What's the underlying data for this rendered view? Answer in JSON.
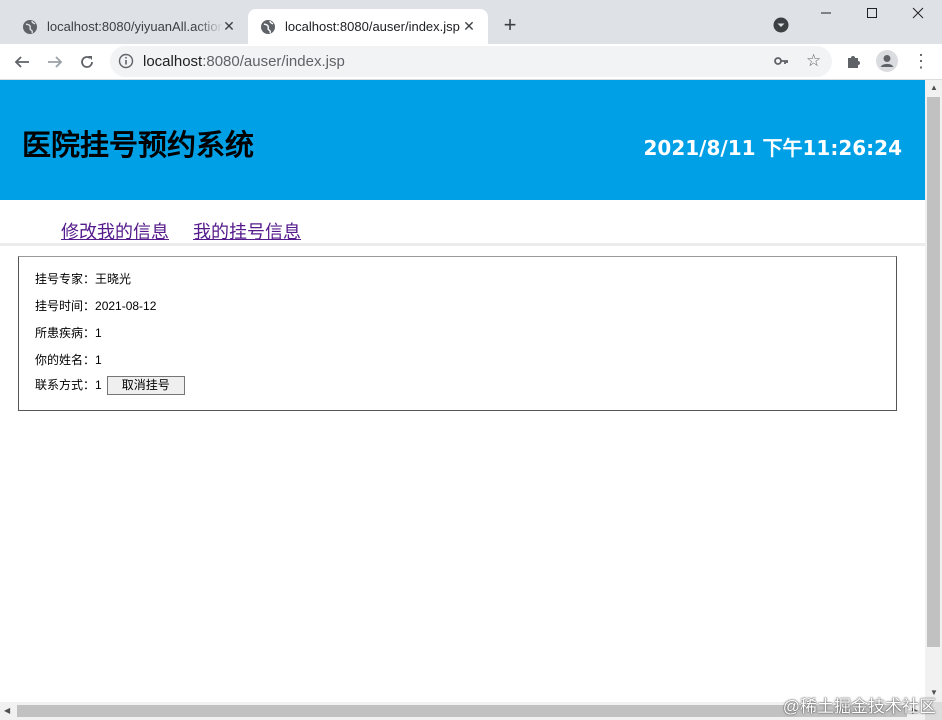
{
  "browser": {
    "tabs": [
      {
        "title": "localhost:8080/yiyuanAll.action",
        "active": false
      },
      {
        "title": "localhost:8080/auser/index.jsp",
        "active": true
      }
    ],
    "url_host": "localhost",
    "url_rest": ":8080/auser/index.jsp"
  },
  "header": {
    "title": "医院挂号预约系统",
    "clock": "2021/8/11 下午11:26:24",
    "bg_color": "#00a0e6"
  },
  "nav": {
    "links": [
      "修改我的信息",
      "我的挂号信息"
    ]
  },
  "appointment": {
    "expert_label": "挂号专家：",
    "expert_value": "王晓光",
    "time_label": "挂号时间：",
    "time_value": "2021-08-12",
    "disease_label": "所患疾病：",
    "disease_value": "1",
    "name_label": "你的姓名：",
    "name_value": "1",
    "contact_label": "联系方式：",
    "contact_value": "1",
    "cancel_button": "取消挂号"
  },
  "watermark": "@稀土掘金技术社区"
}
